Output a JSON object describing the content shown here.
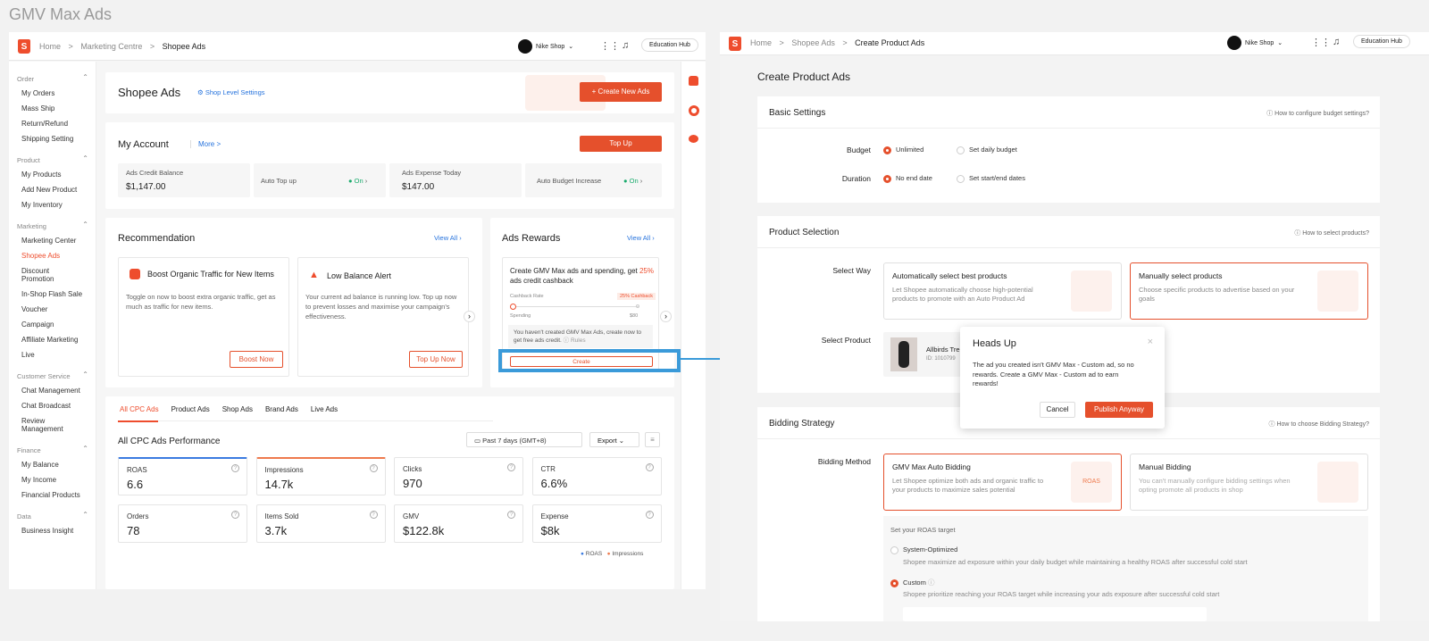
{
  "page_title": "GMV Max Ads",
  "left": {
    "breadcrumb": {
      "home": "Home",
      "sep": ">",
      "marketing": "Marketing Centre",
      "current": "Shopee Ads"
    },
    "shop_name": "Nike Shop",
    "education_hub": "Education Hub",
    "sidebar": [
      {
        "group": "Order",
        "items": [
          "My Orders",
          "Mass Ship",
          "Return/Refund",
          "Shipping Setting"
        ]
      },
      {
        "group": "Product",
        "items": [
          "My Products",
          "Add New Product",
          "My Inventory"
        ]
      },
      {
        "group": "Marketing",
        "items": [
          "Marketing Center",
          "Shopee Ads",
          "Discount Promotion",
          "In-Shop Flash Sale",
          "Voucher",
          "Campaign",
          "Affiliate Marketing",
          "Live"
        ]
      },
      {
        "group": "Customer Service",
        "items": [
          "Chat Management",
          "Chat Broadcast",
          "Review Management"
        ]
      },
      {
        "group": "Finance",
        "items": [
          "My Balance",
          "My Income",
          "Financial Products"
        ]
      },
      {
        "group": "Data",
        "items": [
          "Business Insight"
        ]
      }
    ],
    "active_item": "Shopee Ads",
    "header": {
      "title": "Shopee Ads",
      "settings": "Shop Level Settings",
      "create_button": "+ Create New Ads"
    },
    "account": {
      "title": "My Account",
      "more": "More >",
      "topup_button": "Top Up",
      "credit_label": "Ads Credit Balance",
      "credit_value": "$1,147.00",
      "auto_topup": "Auto Top up",
      "auto_topup_state": "On",
      "expense_label": "Ads Expense Today",
      "expense_value": "$147.00",
      "auto_budget": "Auto Budget Increase",
      "auto_budget_state": "On"
    },
    "recommendation": {
      "title": "Recommendation",
      "view_all": "View All",
      "card1_title": "Boost Organic Traffic for New Items",
      "card1_desc": "Toggle on now to boost extra organic traffic, get as much as traffic for new items.",
      "card1_button": "Boost Now",
      "card2_title": "Low Balance Alert",
      "card2_desc": "Your current ad balance is running low. Top up now to prevent losses and maximise your campaign's effectiveness.",
      "card2_button": "Top Up Now"
    },
    "rewards": {
      "title": "Ads Rewards",
      "view_all": "View All",
      "desc_prefix": "Create GMV Max ads and spending, get ",
      "desc_highlight": "25%",
      "desc_suffix": " ads credit cashback",
      "cashback_rate": "Cashback Rate",
      "cashback_badge": "25% Cashback",
      "spending": "Spending",
      "spending_value": "$80",
      "note": "You haven't created GMV Max Ads, create now to get free ads credit.",
      "rules": "Rules",
      "create_button": "Create"
    },
    "tabs": [
      "All CPC Ads",
      "Product Ads",
      "Shop Ads",
      "Brand Ads",
      "Live Ads"
    ],
    "performance": {
      "title": "All CPC Ads Performance",
      "date": "Past 7 days (GMT+8)",
      "export": "Export",
      "kpis": [
        {
          "label": "ROAS",
          "value": "6.6",
          "accent": "#3b7be0"
        },
        {
          "label": "Impressions",
          "value": "14.7k",
          "accent": "#ee7a4d"
        },
        {
          "label": "Clicks",
          "value": "970",
          "accent": ""
        },
        {
          "label": "CTR",
          "value": "6.6%",
          "accent": ""
        },
        {
          "label": "Orders",
          "value": "78",
          "accent": ""
        },
        {
          "label": "Items Sold",
          "value": "3.7k",
          "accent": ""
        },
        {
          "label": "GMV",
          "value": "$122.8k",
          "accent": ""
        },
        {
          "label": "Expense",
          "value": "$8k",
          "accent": ""
        }
      ],
      "legend": [
        "ROAS",
        "Impressions"
      ]
    }
  },
  "right": {
    "breadcrumb": {
      "home": "Home",
      "sep": ">",
      "shopee_ads": "Shopee Ads",
      "current": "Create Product Ads"
    },
    "shop_name": "Nike Shop",
    "education_hub": "Education Hub",
    "page_heading": "Create Product Ads",
    "basic": {
      "title": "Basic Settings",
      "help": "How to configure budget settings?",
      "budget_label": "Budget",
      "budget_opt1": "Unlimited",
      "budget_opt2": "Set daily budget",
      "duration_label": "Duration",
      "duration_opt1": "No end date",
      "duration_opt2": "Set start/end dates"
    },
    "product": {
      "title": "Product Selection",
      "help": "How to select products?",
      "select_way": "Select Way",
      "auto_title": "Automatically select best products",
      "auto_desc": "Let Shopee automatically choose high-potential products to promote with an Auto Product Ad",
      "manual_title": "Manually select products",
      "manual_desc": "Choose specific products to advertise based on your goals",
      "select_product": "Select Product",
      "product_name": "Allbirds Tre",
      "product_id": "ID: 1010799"
    },
    "bidding": {
      "title": "Bidding Strategy",
      "help": "How to choose Bidding Strategy?",
      "method_label": "Bidding Method",
      "gmv_title": "GMV Max Auto Bidding",
      "gmv_desc": "Let Shopee optimize both ads and organic traffic to your products to maximize sales potential",
      "manual_title": "Manual Bidding",
      "manual_desc": "You can't manually configure bidding settings when opting promote all products in shop",
      "roas_target": "Set your ROAS target",
      "sys_opt": "System-Optimized",
      "sys_desc": "Shopee maximize ad exposure within your daily budget while maintaining a healthy ROAS after successful cold start",
      "custom": "Custom",
      "custom_desc": "Shopee prioritize reaching your ROAS target while increasing your ads exposure after successful cold start",
      "roas_badge": "ROAS"
    },
    "modal": {
      "title": "Heads Up",
      "body": "The ad you created isn't GMV Max - Custom ad, so no rewards. Create a GMV Max - Custom ad to earn rewards!",
      "cancel": "Cancel",
      "publish": "Publish Anyway"
    }
  },
  "colors": {
    "brand": "#ee4d2d",
    "highlight": "#3a9ad9",
    "link": "#2673dd",
    "on": "#1aab6d"
  }
}
